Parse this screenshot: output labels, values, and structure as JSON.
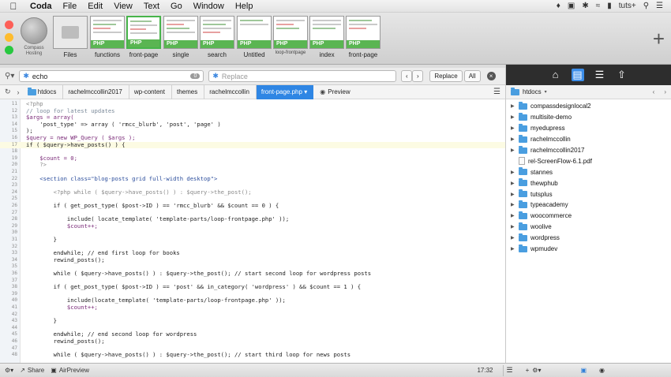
{
  "menubar": {
    "app_name": "Coda",
    "items": [
      "File",
      "Edit",
      "View",
      "Text",
      "Go",
      "Window",
      "Help"
    ],
    "user": "tuts+"
  },
  "site": {
    "name": "Compass Hosting"
  },
  "tabs": [
    {
      "label": "Files",
      "badge": "",
      "thumb": "gray"
    },
    {
      "label": "functions",
      "badge": "PHP",
      "thumb": "code"
    },
    {
      "label": "front-page",
      "badge": "PHP",
      "thumb": "code",
      "active": true
    },
    {
      "label": "single",
      "badge": "PHP",
      "thumb": "code"
    },
    {
      "label": "search",
      "badge": "PHP",
      "thumb": "code"
    },
    {
      "label": "Untitled",
      "badge": "PHP",
      "thumb": "code"
    },
    {
      "label": "loop-frontpage",
      "badge": "PHP",
      "thumb": "code",
      "small": true
    },
    {
      "label": "index",
      "badge": "PHP",
      "thumb": "code"
    },
    {
      "label": "front-page",
      "badge": "PHP",
      "thumb": "code"
    }
  ],
  "search": {
    "query": "echo",
    "count": "0",
    "replace_placeholder": "Replace",
    "replace_label": "Replace",
    "all_label": "All"
  },
  "breadcrumbs": [
    "htdocs",
    "rachelmccollin2017",
    "wp-content",
    "themes",
    "rachelmccollin",
    "front-page.php"
  ],
  "preview_label": "Preview",
  "code": [
    {
      "n": "11",
      "t": "<?php"
    },
    {
      "n": "12",
      "t": "// loop for latest updates"
    },
    {
      "n": "13",
      "t": "$args = array("
    },
    {
      "n": "14",
      "t": "    'post_type' => array ( 'rmcc_blurb', 'post', 'page' )"
    },
    {
      "n": "15",
      "t": ");"
    },
    {
      "n": "16",
      "t": "$query = new WP_Query ( $args );"
    },
    {
      "n": "17",
      "t": "if ( $query->have_posts() ) {"
    },
    {
      "n": "18",
      "t": ""
    },
    {
      "n": "19",
      "t": "    $count = 0;"
    },
    {
      "n": "20",
      "t": "    ?>"
    },
    {
      "n": "21",
      "t": ""
    },
    {
      "n": "22",
      "t": "    <section class=\"blog-posts grid full-width desktop\">"
    },
    {
      "n": "23",
      "t": ""
    },
    {
      "n": "24",
      "t": "        <?php while ( $query->have_posts() ) : $query->the_post();"
    },
    {
      "n": "25",
      "t": ""
    },
    {
      "n": "26",
      "t": "        if ( get_post_type( $post->ID ) == 'rmcc_blurb' && $count == 0 ) {"
    },
    {
      "n": "27",
      "t": ""
    },
    {
      "n": "28",
      "t": "            include( locate_template( 'template-parts/loop-frontpage.php' ));"
    },
    {
      "n": "29",
      "t": "            $count++;"
    },
    {
      "n": "30",
      "t": ""
    },
    {
      "n": "31",
      "t": "        }"
    },
    {
      "n": "32",
      "t": ""
    },
    {
      "n": "33",
      "t": "        endwhile; // end first loop for books"
    },
    {
      "n": "34",
      "t": "        rewind_posts();"
    },
    {
      "n": "35",
      "t": ""
    },
    {
      "n": "36",
      "t": "        while ( $query->have_posts() ) : $query->the_post(); // start second loop for wordpress posts"
    },
    {
      "n": "37",
      "t": ""
    },
    {
      "n": "38",
      "t": "        if ( get_post_type( $post->ID ) == 'post' && in_category( 'wordpress' ) && $count == 1 ) {"
    },
    {
      "n": "39",
      "t": ""
    },
    {
      "n": "40",
      "t": "            include(locate_template( 'template-parts/loop-frontpage.php' ));"
    },
    {
      "n": "41",
      "t": "            $count++;"
    },
    {
      "n": "42",
      "t": ""
    },
    {
      "n": "43",
      "t": "        }"
    },
    {
      "n": "44",
      "t": ""
    },
    {
      "n": "45",
      "t": "        endwhile; // end second loop for wordpress"
    },
    {
      "n": "46",
      "t": "        rewind_posts();"
    },
    {
      "n": "47",
      "t": ""
    },
    {
      "n": "48",
      "t": "        while ( $query->have_posts() ) : $query->the_post(); // start third loop for news posts"
    }
  ],
  "files": {
    "root": "htdocs",
    "items": [
      {
        "name": "compassdesignlocal2",
        "type": "folder"
      },
      {
        "name": "multisite-demo",
        "type": "folder"
      },
      {
        "name": "myedupress",
        "type": "folder"
      },
      {
        "name": "rachelmccollin",
        "type": "folder"
      },
      {
        "name": "rachelmccollin2017",
        "type": "folder"
      },
      {
        "name": "rel-ScreenFlow-6.1.pdf",
        "type": "file"
      },
      {
        "name": "stannes",
        "type": "folder"
      },
      {
        "name": "thewphub",
        "type": "folder"
      },
      {
        "name": "tutsplus",
        "type": "folder"
      },
      {
        "name": "typeacademy",
        "type": "folder"
      },
      {
        "name": "woocommerce",
        "type": "folder"
      },
      {
        "name": "woolive",
        "type": "folder"
      },
      {
        "name": "wordpress",
        "type": "folder"
      },
      {
        "name": "wpmudev",
        "type": "folder"
      }
    ]
  },
  "status": {
    "share": "Share",
    "airpreview": "AirPreview",
    "position": "17:32"
  }
}
